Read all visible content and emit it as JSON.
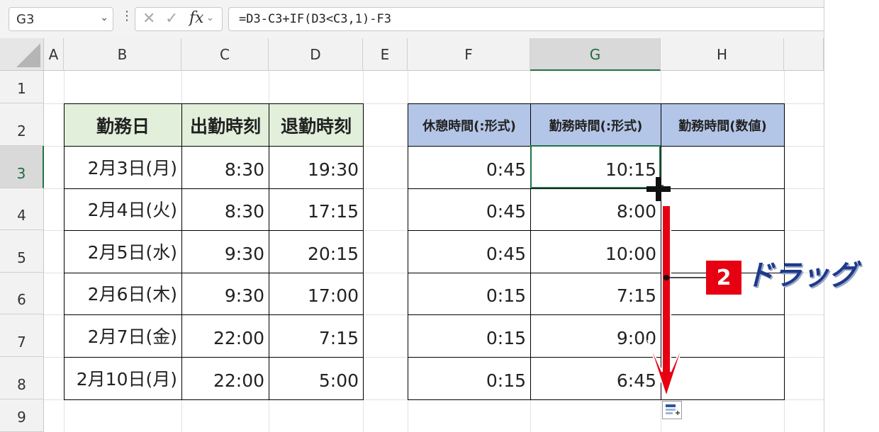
{
  "formula_bar": {
    "name_box": "G3",
    "formula": "=D3-C3+IF(D3<C3,1)-F3",
    "fx_label": "fx"
  },
  "columns": [
    "A",
    "B",
    "C",
    "D",
    "E",
    "F",
    "G",
    "H"
  ],
  "rows": [
    "1",
    "2",
    "3",
    "4",
    "5",
    "6",
    "7",
    "8",
    "9"
  ],
  "table_left": {
    "headers": [
      "勤務日",
      "出勤時刻",
      "退勤時刻"
    ],
    "rows": [
      [
        "2月3日(月)",
        "8:30",
        "19:30"
      ],
      [
        "2月4日(火)",
        "8:30",
        "17:15"
      ],
      [
        "2月5日(水)",
        "9:30",
        "20:15"
      ],
      [
        "2月6日(木)",
        "9:30",
        "17:00"
      ],
      [
        "2月7日(金)",
        "22:00",
        "7:15"
      ],
      [
        "2月10日(月)",
        "22:00",
        "5:00"
      ]
    ]
  },
  "table_right": {
    "headers": [
      "休憩時間(:形式)",
      "勤務時間(:形式)",
      "勤務時間(数値)"
    ],
    "rows": [
      [
        "0:45",
        "10:15",
        ""
      ],
      [
        "0:45",
        "8:00",
        ""
      ],
      [
        "0:45",
        "10:00",
        ""
      ],
      [
        "0:15",
        "7:15",
        ""
      ],
      [
        "0:15",
        "9:00",
        ""
      ],
      [
        "0:15",
        "6:45",
        ""
      ]
    ]
  },
  "annotation": {
    "step": "2",
    "label": "ドラッグ",
    "arrow_color": "#e60012"
  },
  "colors": {
    "header_green": "#e2efda",
    "header_blue": "#b4c6e7",
    "selection": "#217346"
  }
}
